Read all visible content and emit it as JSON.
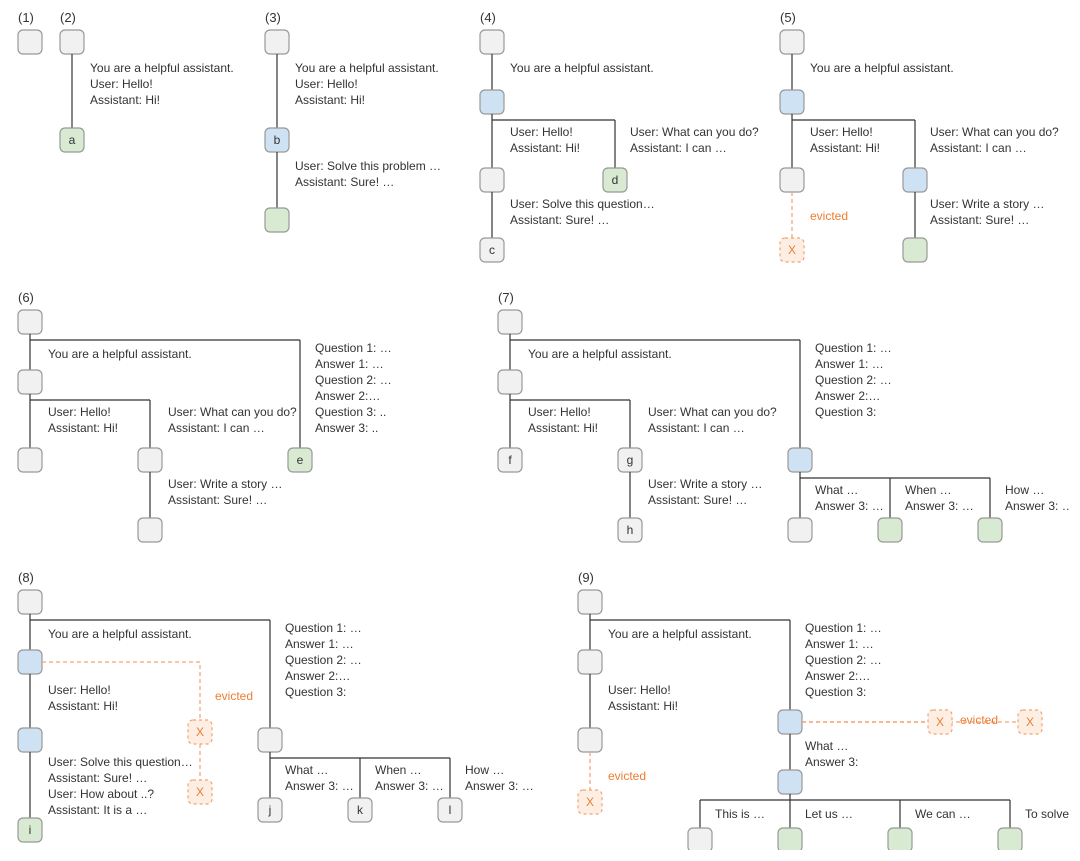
{
  "labels": {
    "p1": "(1)",
    "p2": "(2)",
    "p3": "(3)",
    "p4": "(4)",
    "p5": "(5)",
    "p6": "(6)",
    "p7": "(7)",
    "p8": "(8)",
    "p9": "(9)"
  },
  "text": {
    "sys": "You are a helpful assistant.",
    "hello_user": "User: Hello!",
    "hello_asst": "Assistant: Hi!",
    "solve_problem_u": "User: Solve this problem …",
    "solve_problem_a": "Assistant: Sure! …",
    "solve_question_u": "User: Solve this question…",
    "solve_question_a": "Assistant: Sure! …",
    "whatcan_u": "User: What can you do?",
    "whatcan_a": "Assistant: I can …",
    "write_story_u": "User: Write a story …",
    "write_story_a": "Assistant: Sure! …",
    "howabout_u": "User: How about ..?",
    "howabout_a": "Assistant: It is a …",
    "q1": "Question 1: …",
    "a1": "Answer 1: …",
    "q2": "Question 2: …",
    "a2": "Answer 2:…",
    "q3d": "Question 3: ..",
    "a3d": "Answer 3: ..",
    "q3": "Question 3:",
    "what": "What …",
    "when": "When …",
    "how": "How …",
    "ans3": "Answer 3: …",
    "ans3b": "Answer 3:",
    "thisis": "This is …",
    "letus": "Let us …",
    "wecan": "We can …",
    "tosolve": "To solve …",
    "evicted": "evicted"
  },
  "letters": {
    "a": "a",
    "b": "b",
    "c": "c",
    "d": "d",
    "e": "e",
    "f": "f",
    "g": "g",
    "h": "h",
    "i": "i",
    "j": "j",
    "k": "k",
    "l": "l",
    "X": "X"
  }
}
